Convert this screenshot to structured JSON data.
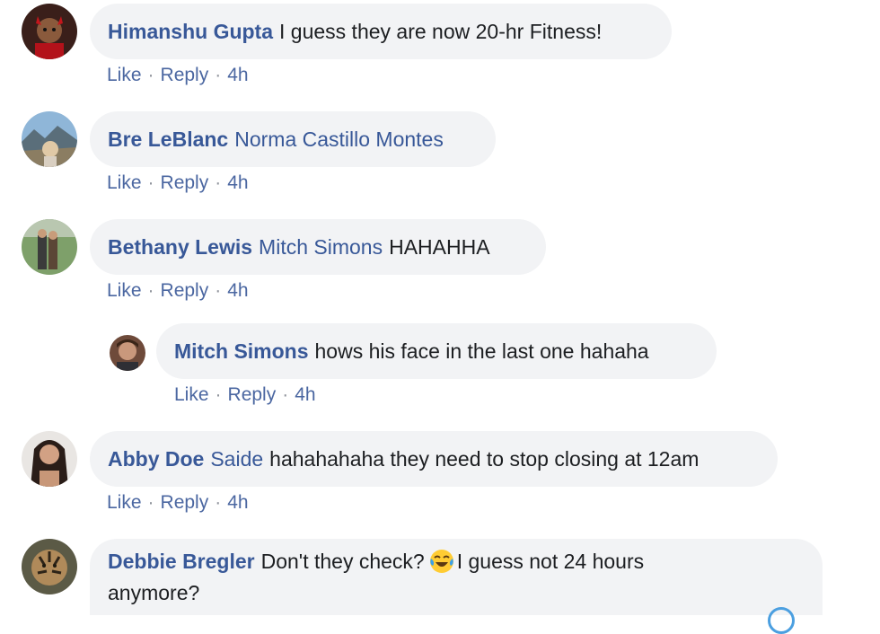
{
  "comments": [
    {
      "author": "Himanshu Gupta",
      "mention": "",
      "text": "I guess they are now 20-hr Fitness!",
      "like": "Like",
      "reply": "Reply",
      "sep": "·",
      "time": "4h",
      "avatar_icon": "avatar-devil-horns"
    },
    {
      "author": "Bre LeBlanc",
      "mention": "Norma Castillo Montes",
      "text": "",
      "like": "Like",
      "reply": "Reply",
      "sep": "·",
      "time": "4h",
      "avatar_icon": "avatar-mountain-photo"
    },
    {
      "author": "Bethany Lewis",
      "mention": "Mitch Simons",
      "text": "HAHAHHA",
      "like": "Like",
      "reply": "Reply",
      "sep": "·",
      "time": "4h",
      "avatar_icon": "avatar-couple-field"
    },
    {
      "author": "Mitch Simons",
      "mention": "",
      "text": "hows his face in the last one hahaha",
      "like": "Like",
      "reply": "Reply",
      "sep": "·",
      "time": "4h",
      "avatar_icon": "avatar-man-portrait",
      "is_reply": true
    },
    {
      "author": "Abby Doe",
      "mention": "Saide",
      "text": "hahahahaha they need to stop closing at 12am",
      "like": "Like",
      "reply": "Reply",
      "sep": "·",
      "time": "4h",
      "avatar_icon": "avatar-woman-portrait"
    },
    {
      "author": "Debbie Bregler",
      "mention": "",
      "text_before_emoji": "Don't they check?",
      "emoji": "tears-of-joy-emoji",
      "text_after_emoji": "I guess not 24 hours",
      "text_line2": "anymore?",
      "avatar_icon": "avatar-tiger-photo"
    }
  ]
}
